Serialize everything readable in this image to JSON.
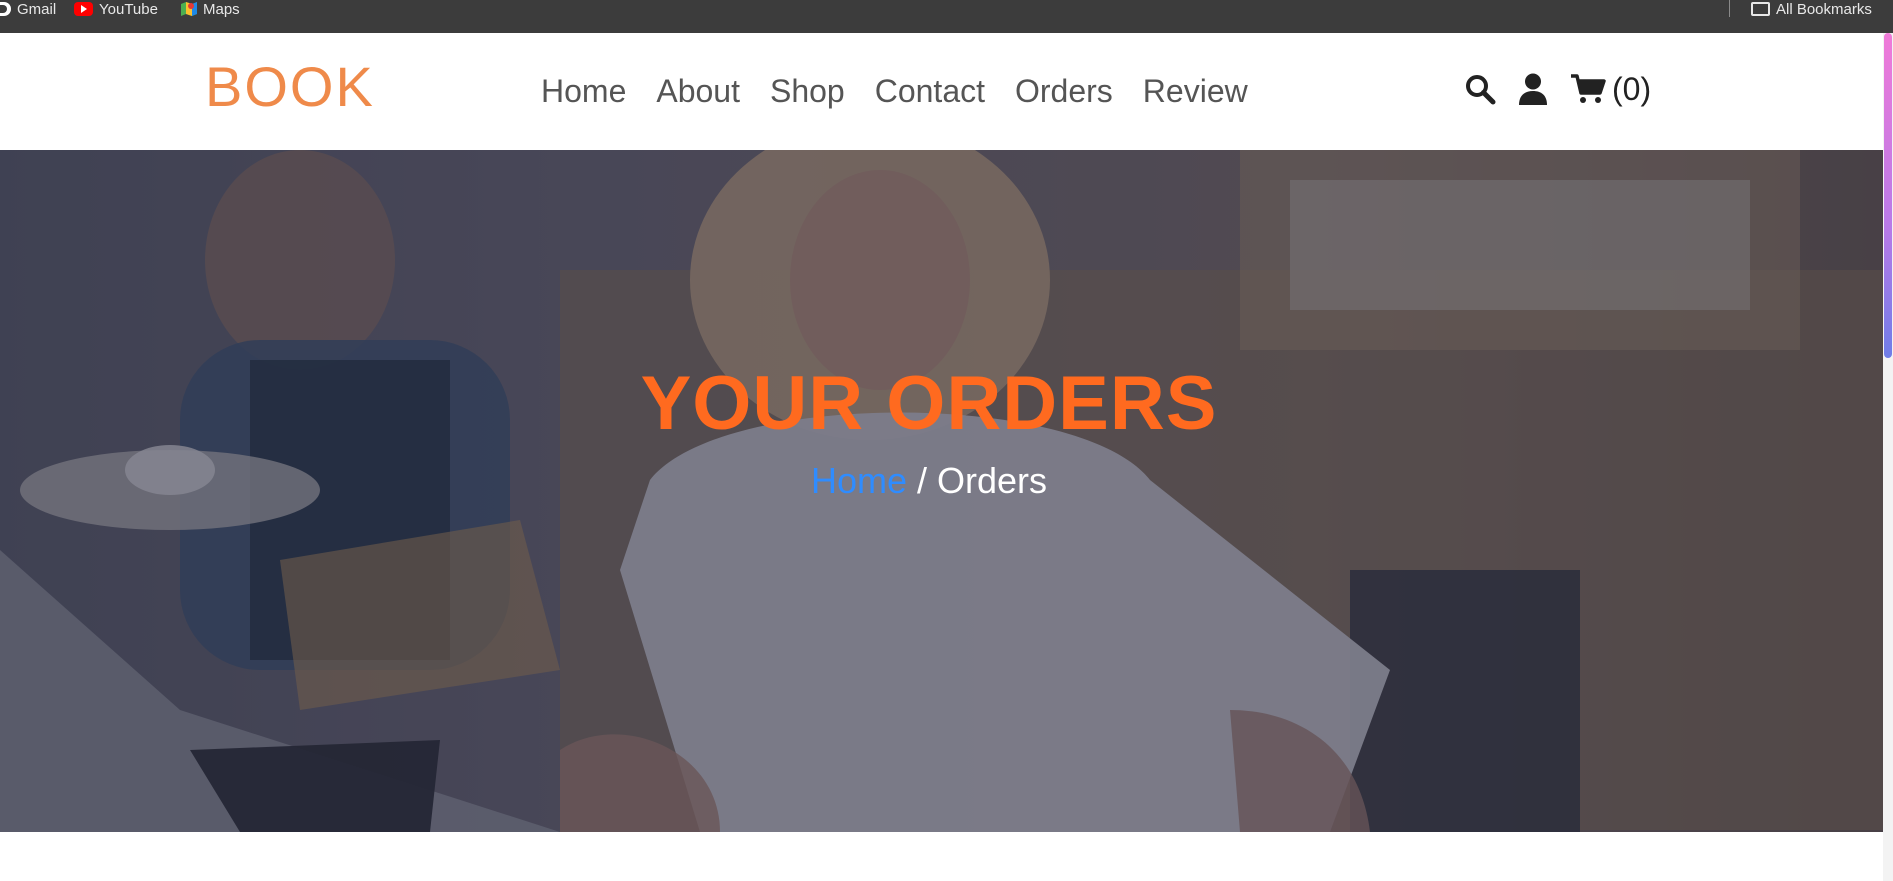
{
  "bookmarks": {
    "items": [
      {
        "label": "Gmail",
        "icon": "google-icon"
      },
      {
        "label": "YouTube",
        "icon": "youtube-icon"
      },
      {
        "label": "Maps",
        "icon": "maps-icon"
      }
    ],
    "all_bookmarks": "All Bookmarks"
  },
  "header": {
    "logo": "BOOK",
    "nav": [
      "Home",
      "About",
      "Shop",
      "Contact",
      "Orders",
      "Review"
    ],
    "icons": [
      "search-icon",
      "user-icon",
      "cart-icon"
    ],
    "cart_count": "(0)"
  },
  "hero": {
    "title": "YOUR ORDERS",
    "breadcrumb_home": "Home",
    "breadcrumb_sep": " / ",
    "breadcrumb_current": "Orders"
  },
  "colors": {
    "logo": "#ef8a4a",
    "title": "#ff6a1f",
    "link": "#2f8cff",
    "nav_text": "#555555"
  }
}
